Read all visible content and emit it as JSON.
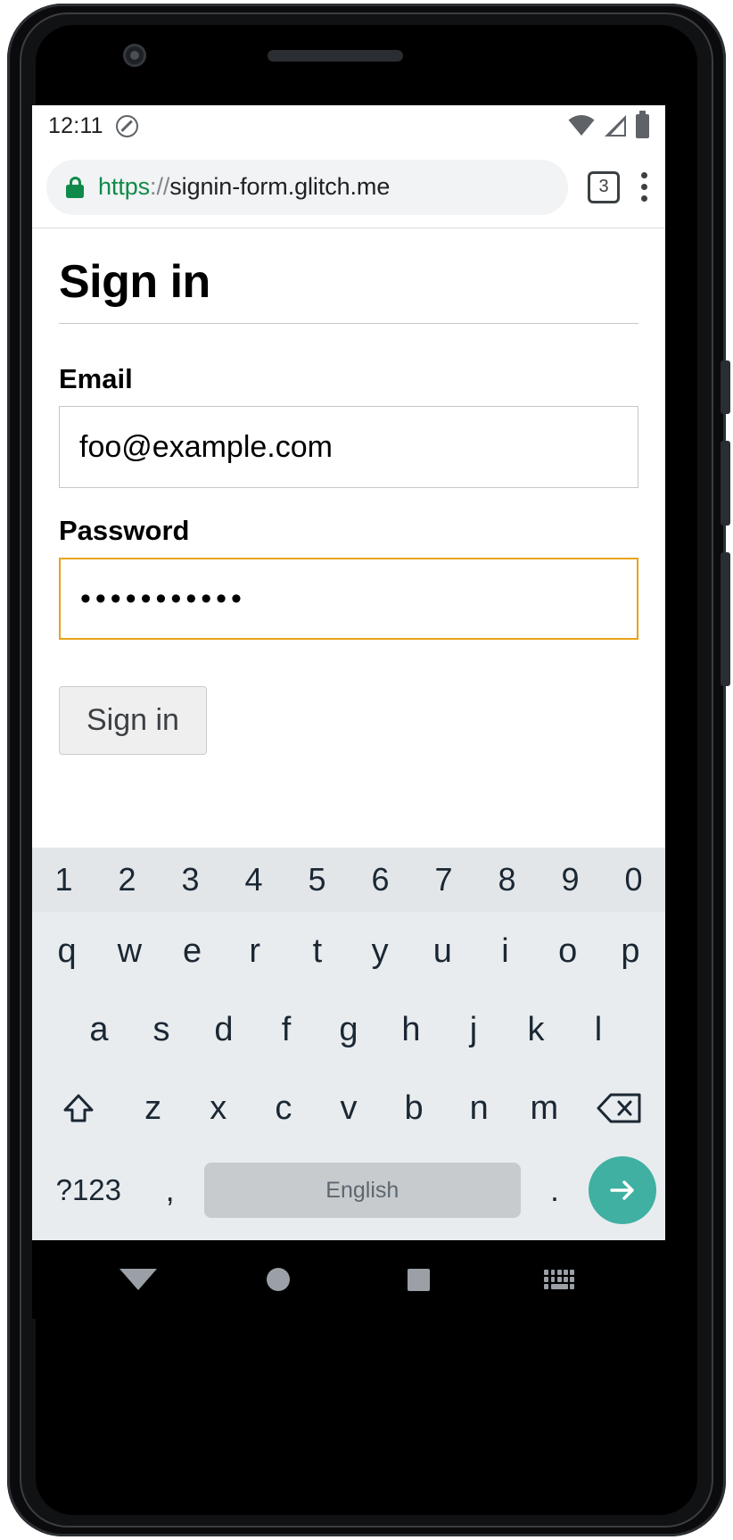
{
  "status_bar": {
    "time": "12:11",
    "icons": [
      "do-not-disturb-icon",
      "wifi-icon",
      "cell-signal-icon",
      "battery-icon"
    ]
  },
  "browser": {
    "url_scheme": "https",
    "url_separator": "://",
    "url_host": "signin-form.glitch.me",
    "tab_count": "3",
    "lock_icon": "lock-icon",
    "menu_icon": "overflow-menu-icon"
  },
  "page": {
    "heading": "Sign in",
    "email": {
      "label": "Email",
      "value": "foo@example.com"
    },
    "password": {
      "label": "Password",
      "value": "•••••••••••",
      "focused": true,
      "focus_color": "#e8a317"
    },
    "submit_label": "Sign in"
  },
  "keyboard": {
    "numbers": [
      "1",
      "2",
      "3",
      "4",
      "5",
      "6",
      "7",
      "8",
      "9",
      "0"
    ],
    "row1": [
      "q",
      "w",
      "e",
      "r",
      "t",
      "y",
      "u",
      "i",
      "o",
      "p"
    ],
    "row2": [
      "a",
      "s",
      "d",
      "f",
      "g",
      "h",
      "j",
      "k",
      "l"
    ],
    "row3": [
      "z",
      "x",
      "c",
      "v",
      "b",
      "n",
      "m"
    ],
    "shift_icon": "shift-icon",
    "backspace_icon": "backspace-icon",
    "symbols_label": "?123",
    "comma_label": ",",
    "space_label": "English",
    "period_label": ".",
    "enter_icon": "arrow-right-icon",
    "enter_color": "#3fb0a2"
  },
  "nav_bar": {
    "back": "back-icon",
    "home": "home-icon",
    "recents": "recents-icon",
    "hide_keyboard": "hide-keyboard-icon"
  }
}
